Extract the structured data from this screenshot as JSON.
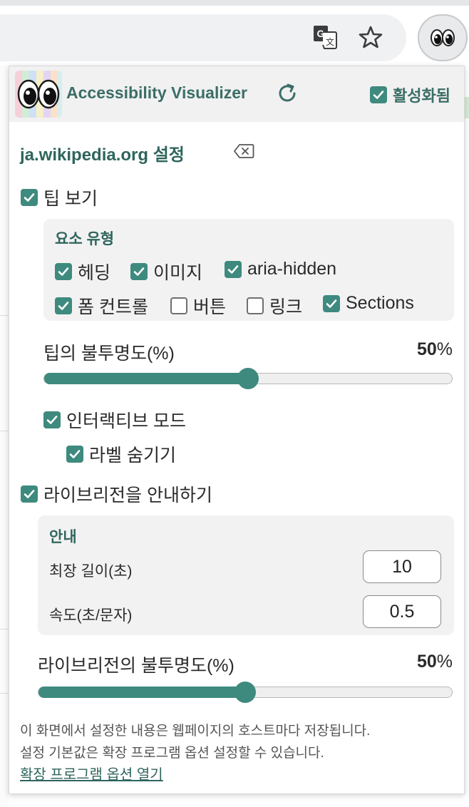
{
  "toolbar": {
    "translate_icon": "translate-icon",
    "bookmark_icon": "star-icon",
    "extension_icon": "eyes-icon"
  },
  "header": {
    "title": "Accessibility Visualizer",
    "enabled_label": "활성화됨",
    "enabled": true
  },
  "site": {
    "title": "ja.wikipedia.org 설정"
  },
  "tips": {
    "label": "팁 보기",
    "checked": true,
    "element_types": {
      "title": "요소 유형",
      "items": [
        {
          "label": "헤딩",
          "checked": true
        },
        {
          "label": "이미지",
          "checked": true
        },
        {
          "label": "aria-hidden",
          "checked": true
        },
        {
          "label": "폼 컨트롤",
          "checked": true
        },
        {
          "label": "버튼",
          "checked": false
        },
        {
          "label": "링크",
          "checked": false
        },
        {
          "label": "Sections",
          "checked": true
        }
      ]
    },
    "opacity": {
      "label": "팁의 불투명도(%)",
      "value": "50",
      "unit": "%",
      "fraction": 0.5
    },
    "interactive_mode": {
      "label": "인터랙티브 모드",
      "checked": true
    },
    "hide_labels": {
      "label": "라벨 숨기기",
      "checked": true
    }
  },
  "live_region": {
    "label": "라이브리전을 안내하기",
    "checked": true,
    "announce": {
      "title": "안내",
      "max_length_label": "최장 길이(초)",
      "max_length_value": "10",
      "speed_label": "속도(초/문자)",
      "speed_value": "0.5"
    },
    "opacity": {
      "label": "라이브리전의 불투명도(%)",
      "value": "50",
      "unit": "%",
      "fraction": 0.5
    }
  },
  "footer": {
    "note_line1": "이 화면에서 설정한 내용은 웹페이지의 호스트마다 저장됩니다.",
    "note_line2": "설정 기본값은 확장 프로그램 옵션 설정할 수 있습니다.",
    "options_link": "확장 프로그램 옵션 열기"
  },
  "colors": {
    "accent": "#3e8a7e",
    "heading": "#2f655d",
    "panel": "#f2f2f2"
  }
}
